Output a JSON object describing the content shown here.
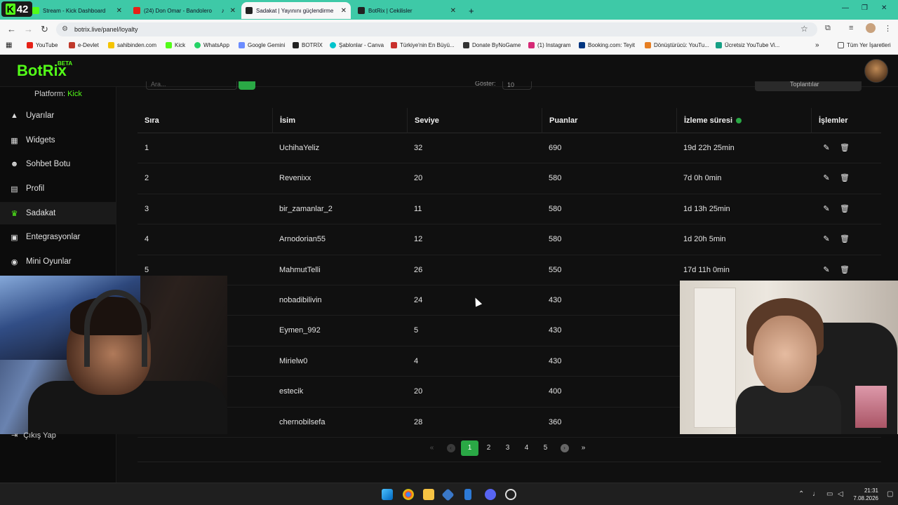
{
  "browser": {
    "tabs": [
      {
        "label": "Stream - Kick Dashboard",
        "active": false,
        "color": "#53fc18"
      },
      {
        "label": "(24) Don Omar - Bandolero",
        "active": false,
        "color": "#e62117"
      },
      {
        "label": "Sadakat | Yayınını güçlendirme",
        "active": true,
        "color": "#222222"
      },
      {
        "label": "BotRix | Cekilisler",
        "active": false,
        "color": "#222222"
      }
    ],
    "kick_badge": "42",
    "new_tab": "+",
    "url": "botrix.live/panel/loyalty",
    "bookmarks": [
      {
        "label": "YouTube",
        "color": "#e62117"
      },
      {
        "label": "e-Devlet",
        "color": "#c0392b"
      },
      {
        "label": "sahibinden.com",
        "color": "#f5c400"
      },
      {
        "label": "Kick",
        "color": "#53fc18"
      },
      {
        "label": "WhatsApp",
        "color": "#25d366"
      },
      {
        "label": "Google Gemini",
        "color": "#6b8cff"
      },
      {
        "label": "BOTRİX",
        "color": "#222222"
      },
      {
        "label": "Şablonlar - Canva",
        "color": "#00c4cc"
      },
      {
        "label": "Türkiye'nin En Büyü...",
        "color": "#c9302c"
      },
      {
        "label": "Donate ByNoGame",
        "color": "#333333"
      },
      {
        "label": "(1) Instagram",
        "color": "#d62976"
      },
      {
        "label": "Booking.com: Teyit",
        "color": "#003580"
      },
      {
        "label": "Dönüştürücü: YouTu...",
        "color": "#e67e22"
      },
      {
        "label": "Ücretsiz YouTube Vi...",
        "color": "#16a085"
      }
    ],
    "all_bookmarks": "Tüm Yer İşaretleri"
  },
  "app": {
    "logo": "BotRix",
    "beta": "BETA",
    "platform_label": "Platform:",
    "platform_value": "Kick",
    "sidebar": [
      {
        "label": "Uyarılar",
        "icon": "warning-icon",
        "glyph": "▲",
        "active": false
      },
      {
        "label": "Widgets",
        "icon": "grid-icon",
        "glyph": "▦",
        "active": false
      },
      {
        "label": "Sohbet Botu",
        "icon": "robot-icon",
        "glyph": "☻",
        "active": false
      },
      {
        "label": "Profil",
        "icon": "id-card-icon",
        "glyph": "▤",
        "active": false
      },
      {
        "label": "Sadakat",
        "icon": "trophy-icon",
        "glyph": "♛",
        "active": true
      },
      {
        "label": "Entegrasyonlar",
        "icon": "plug-icon",
        "glyph": "▣",
        "active": false
      },
      {
        "label": "Mini Oyunlar",
        "icon": "gamepad-icon",
        "glyph": "◉",
        "active": false
      }
    ],
    "logout": "Çıkış Yap",
    "filters": {
      "search_placeholder": "Ara...",
      "show_label": "Göster:",
      "show_value": "10",
      "download_label": "Toplantılar"
    },
    "table": {
      "headers": [
        "Sıra",
        "İsim",
        "Seviye",
        "Puanlar",
        "İzleme süresi",
        "İşlemler"
      ],
      "rows": [
        {
          "rank": "1",
          "name": "UchihaYeliz",
          "level": "32",
          "points": "690",
          "watch": "19d 22h 25min"
        },
        {
          "rank": "2",
          "name": "Revenixx",
          "level": "20",
          "points": "580",
          "watch": "7d 0h 0min"
        },
        {
          "rank": "3",
          "name": "bir_zamanlar_2",
          "level": "11",
          "points": "580",
          "watch": "1d 13h 25min"
        },
        {
          "rank": "4",
          "name": "Arnodorian55",
          "level": "12",
          "points": "580",
          "watch": "1d 20h 5min"
        },
        {
          "rank": "5",
          "name": "MahmutTelli",
          "level": "26",
          "points": "550",
          "watch": "17d 11h 0min"
        },
        {
          "rank": "",
          "name": "nobadibilivin",
          "level": "24",
          "points": "430",
          "watch": ""
        },
        {
          "rank": "",
          "name": "Eymen_992",
          "level": "5",
          "points": "430",
          "watch": ""
        },
        {
          "rank": "",
          "name": "Mirielw0",
          "level": "4",
          "points": "430",
          "watch": ""
        },
        {
          "rank": "",
          "name": "estecik",
          "level": "20",
          "points": "400",
          "watch": ""
        },
        {
          "rank": "",
          "name": "chernobilsefa",
          "level": "28",
          "points": "360",
          "watch": ""
        }
      ]
    },
    "pagination": {
      "first": "«",
      "prev": "‹",
      "pages": [
        "1",
        "2",
        "3",
        "4",
        "5"
      ],
      "current": "1",
      "next": "›",
      "last": "»"
    }
  },
  "taskbar": {
    "time": "21:31",
    "date": "7.08.2026"
  },
  "colors": {
    "accent": "#53fc18",
    "button_green": "#2aa845",
    "background": "#101010"
  }
}
